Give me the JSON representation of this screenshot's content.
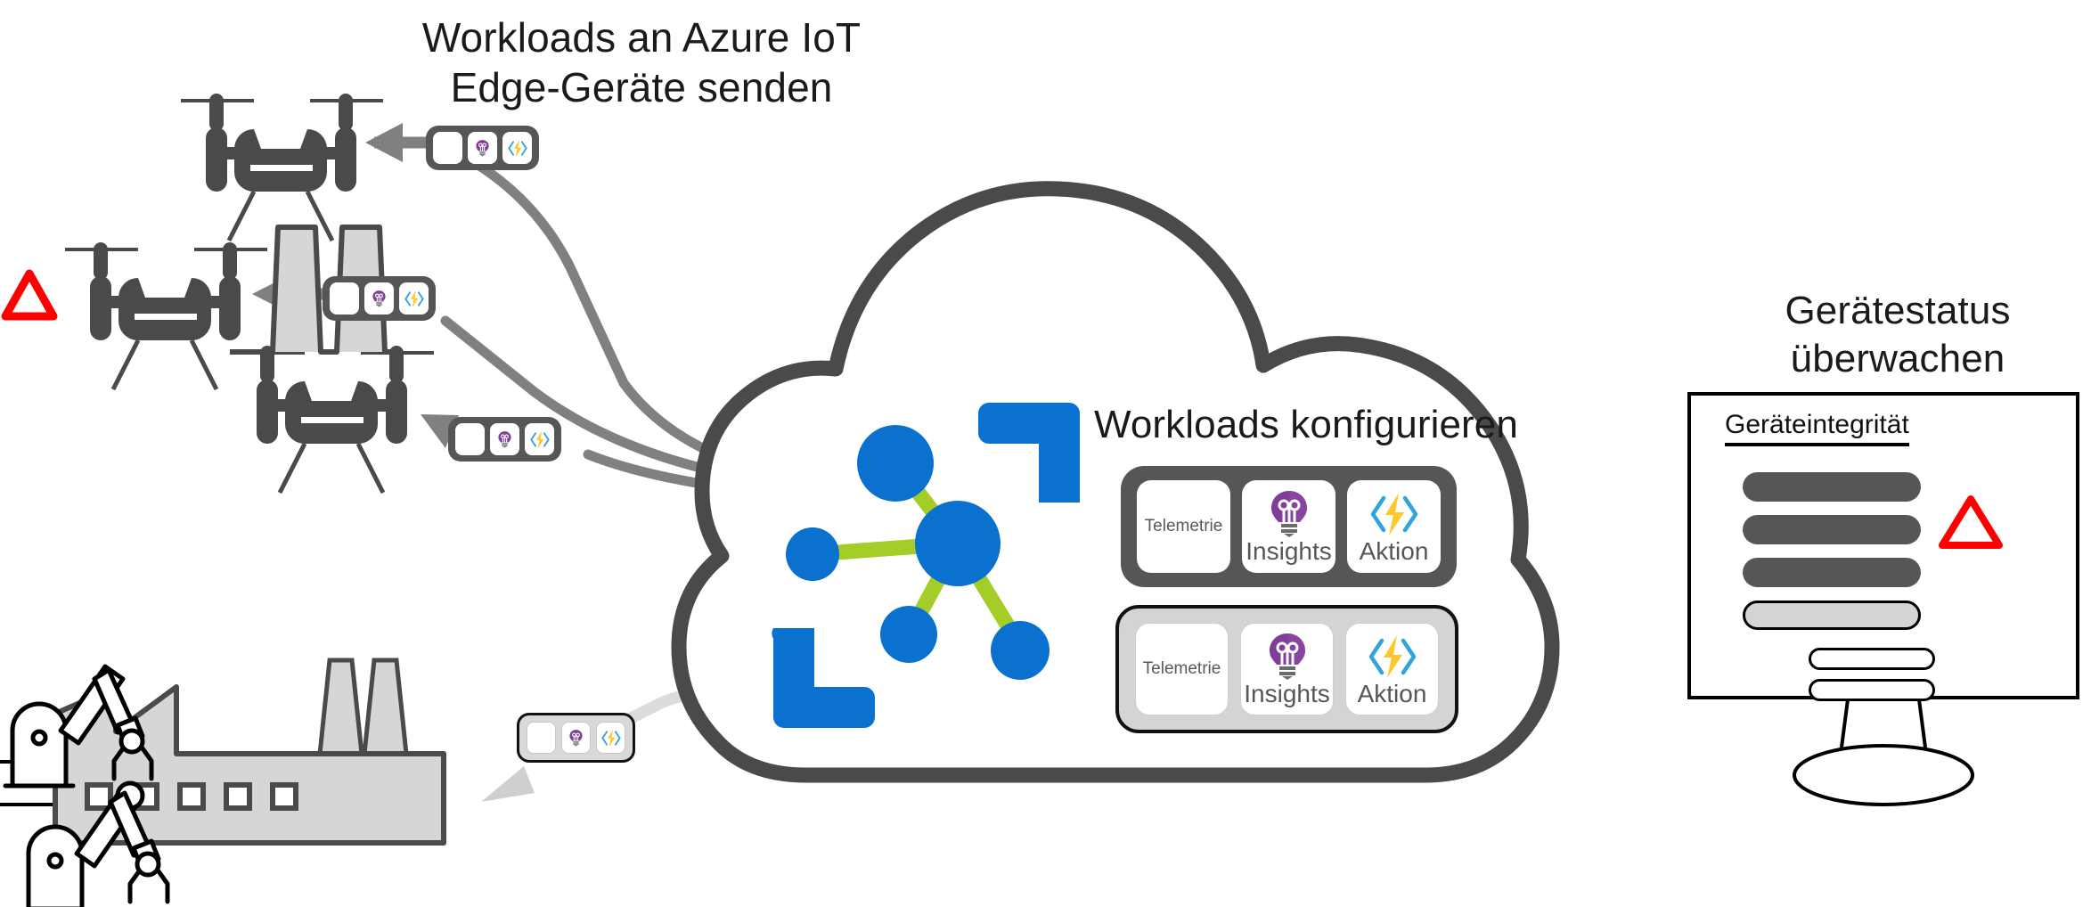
{
  "diagram": {
    "title_send": "Workloads an Azure IoT Edge-Geräte senden",
    "title_send_line1": "Workloads an Azure IoT",
    "title_send_line2": "Edge-Geräte senden",
    "title_configure": "Workloads konfigurieren",
    "title_monitor_line1": "Gerätestatus",
    "title_monitor_line2": "überwachen"
  },
  "colors": {
    "dark_gray": "#565656",
    "light_gray": "#d4d4d4",
    "azure_blue": "#0A72CE",
    "lime_green": "#A4CE27",
    "insight_purple": "#7F3F98",
    "action_yellow": "#FFC72C",
    "action_cyan": "#2EA3DC",
    "alert_red": "#FF0000",
    "outline_black": "#111111"
  },
  "workload_panels": [
    {
      "id": "panel-primary",
      "style": "dark",
      "cards": [
        {
          "label": "Telemetrie",
          "icon": "text-only"
        },
        {
          "label": "Insights",
          "icon": "lightbulb-icon"
        },
        {
          "label": "Aktion",
          "icon": "lightning-bolt-icon"
        }
      ]
    },
    {
      "id": "panel-secondary",
      "style": "light",
      "cards": [
        {
          "label": "Telemetrie",
          "icon": "text-only"
        },
        {
          "label": "Insights",
          "icon": "lightbulb-icon"
        },
        {
          "label": "Aktion",
          "icon": "lightning-bolt-icon"
        }
      ]
    }
  ],
  "device_badges": [
    {
      "id": "badge-drone-1",
      "target": "drone-1",
      "style": "dark",
      "icons": [
        "blank-icon",
        "lightbulb-icon",
        "lightning-bolt-icon"
      ]
    },
    {
      "id": "badge-drone-2",
      "target": "drone-2",
      "style": "dark",
      "icons": [
        "blank-icon",
        "lightbulb-icon",
        "lightning-bolt-icon"
      ]
    },
    {
      "id": "badge-drone-3",
      "target": "drone-3",
      "style": "dark",
      "icons": [
        "blank-icon",
        "lightbulb-icon",
        "lightning-bolt-icon"
      ]
    },
    {
      "id": "badge-factory",
      "target": "factory",
      "style": "light",
      "icons": [
        "blank-icon",
        "lightbulb-icon",
        "lightning-bolt-icon"
      ]
    }
  ],
  "monitor": {
    "heading": "Geräteintegrität",
    "rows": [
      {
        "type": "solid"
      },
      {
        "type": "solid"
      },
      {
        "type": "solid"
      },
      {
        "type": "fill"
      },
      {
        "type": "hollow"
      },
      {
        "type": "hollow"
      }
    ],
    "alert": "warning-triangle-icon"
  },
  "devices": [
    {
      "name": "drone-1"
    },
    {
      "name": "drone-2",
      "alert": "warning-triangle-icon"
    },
    {
      "name": "drone-3"
    },
    {
      "name": "factory"
    },
    {
      "name": "robot-arm-1"
    },
    {
      "name": "robot-arm-2"
    }
  ],
  "cloud": {
    "name": "azure-cloud",
    "network_nodes": 5,
    "brackets": 2
  }
}
